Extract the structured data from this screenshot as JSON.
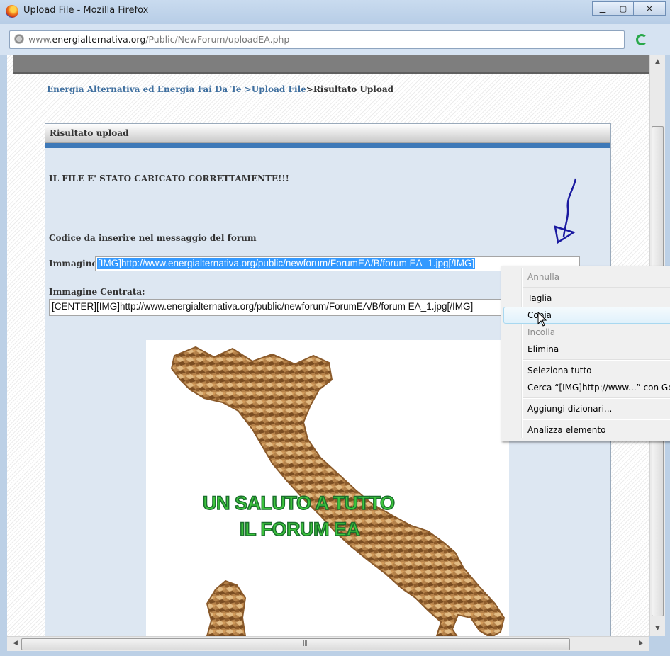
{
  "window": {
    "title": "Upload File - Mozilla Firefox",
    "buttons": [
      "minimize",
      "maximize",
      "close"
    ]
  },
  "address_bar": {
    "url_domain": "www.energialternativa.org",
    "url_prefix": "www.",
    "url_host": "energialternativa.org",
    "url_path": "/Public/NewForum/uploadEA.php"
  },
  "page": {
    "breadcrumb": {
      "item1": "Energia Alternativa ed Energia Fai Da Te",
      "item2": ">Upload File",
      "current": ">Risultato Upload"
    },
    "panel_title": "Risultato upload",
    "success_message": "IL FILE E' STATO CARICATO CORRETTAMENTE!!!",
    "code_heading": "Codice da inserire nel messaggio del forum",
    "image_label": "Immagine:",
    "image_code": "[IMG]http://www.energialternativa.org/public/newforum/ForumEA/B/forum EA_1.jpg[/IMG]",
    "centered_label": "Immagine Centrata:",
    "centered_code": "[CENTER][IMG]http://www.energialternativa.org/public/newforum/ForumEA/B/forum EA_1.jpg[/IMG]",
    "image_caption_line1": "UN SALUTO  A TUTTO",
    "image_caption_line2": "IL FORUM EA"
  },
  "context_menu": {
    "items": [
      {
        "label": "Annulla",
        "disabled": true
      },
      {
        "label": "Taglia",
        "disabled": false
      },
      {
        "label": "Copia",
        "disabled": false,
        "highlighted": true
      },
      {
        "label": "Incolla",
        "disabled": true
      },
      {
        "label": "Elimina",
        "disabled": false
      },
      {
        "label": "Seleziona tutto",
        "disabled": false
      },
      {
        "label": "Cerca “[IMG]http://www...” con Go",
        "disabled": false
      },
      {
        "label": "Aggiungi dizionari...",
        "disabled": false
      },
      {
        "label": "Analizza elemento",
        "disabled": false
      }
    ]
  },
  "colors": {
    "link": "#3f6f9f",
    "panel_bar": "#3e79b8",
    "selection": "#3399ff",
    "caption_green": "#3cc43c",
    "annotation_arrow": "#1a1aa0"
  }
}
